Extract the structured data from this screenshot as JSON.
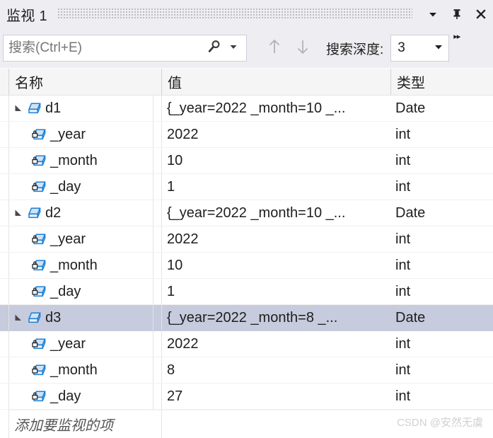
{
  "window": {
    "title": "监视 1",
    "controls": {
      "dropdown": "chevron-down-icon",
      "pin": "pin-icon",
      "close": "close-icon"
    }
  },
  "toolbar": {
    "search_placeholder": "搜索(Ctrl+E)",
    "search_value": "",
    "search_icon": "magnifier-icon",
    "search_dropdown_icon": "chevron-down-icon",
    "nav_up_icon": "arrow-up-icon",
    "nav_down_icon": "arrow-down-icon",
    "depth_label": "搜索深度:",
    "depth_value": "3",
    "depth_dropdown_icon": "chevron-down-icon",
    "overflow_icon": "▸▸"
  },
  "grid": {
    "columns": [
      "名称",
      "值",
      "类型"
    ],
    "rows": [
      {
        "name": "d1",
        "value": "{_year=2022 _month=10 _...",
        "type": "Date",
        "level": 0,
        "expanded": true,
        "private": false,
        "value_changed": true,
        "selected": false
      },
      {
        "name": "_year",
        "value": "2022",
        "type": "int",
        "level": 1,
        "expanded": false,
        "private": true,
        "value_changed": false,
        "selected": false
      },
      {
        "name": "_month",
        "value": "10",
        "type": "int",
        "level": 1,
        "expanded": false,
        "private": true,
        "value_changed": true,
        "selected": false
      },
      {
        "name": "_day",
        "value": "1",
        "type": "int",
        "level": 1,
        "expanded": false,
        "private": true,
        "value_changed": true,
        "selected": false
      },
      {
        "name": "d2",
        "value": "{_year=2022 _month=10 _...",
        "type": "Date",
        "level": 0,
        "expanded": true,
        "private": false,
        "value_changed": false,
        "selected": false
      },
      {
        "name": "_year",
        "value": "2022",
        "type": "int",
        "level": 1,
        "expanded": false,
        "private": true,
        "value_changed": false,
        "selected": false
      },
      {
        "name": "_month",
        "value": "10",
        "type": "int",
        "level": 1,
        "expanded": false,
        "private": true,
        "value_changed": false,
        "selected": false
      },
      {
        "name": "_day",
        "value": "1",
        "type": "int",
        "level": 1,
        "expanded": false,
        "private": true,
        "value_changed": false,
        "selected": false
      },
      {
        "name": "d3",
        "value": "{_year=2022 _month=8 _...",
        "type": "Date",
        "level": 0,
        "expanded": true,
        "private": false,
        "value_changed": false,
        "selected": true
      },
      {
        "name": "_year",
        "value": "2022",
        "type": "int",
        "level": 1,
        "expanded": false,
        "private": true,
        "value_changed": false,
        "selected": false
      },
      {
        "name": "_month",
        "value": "8",
        "type": "int",
        "level": 1,
        "expanded": false,
        "private": true,
        "value_changed": false,
        "selected": false
      },
      {
        "name": "_day",
        "value": "27",
        "type": "int",
        "level": 1,
        "expanded": false,
        "private": true,
        "value_changed": false,
        "selected": false
      }
    ],
    "add_item_placeholder": "添加要监视的项"
  },
  "watermark": "CSDN @安然无虞",
  "colors": {
    "changed_value": "#e01b24",
    "selection": "#c6cbdd",
    "chrome": "#eeeef2",
    "object_icon": "#1d7fd4"
  }
}
